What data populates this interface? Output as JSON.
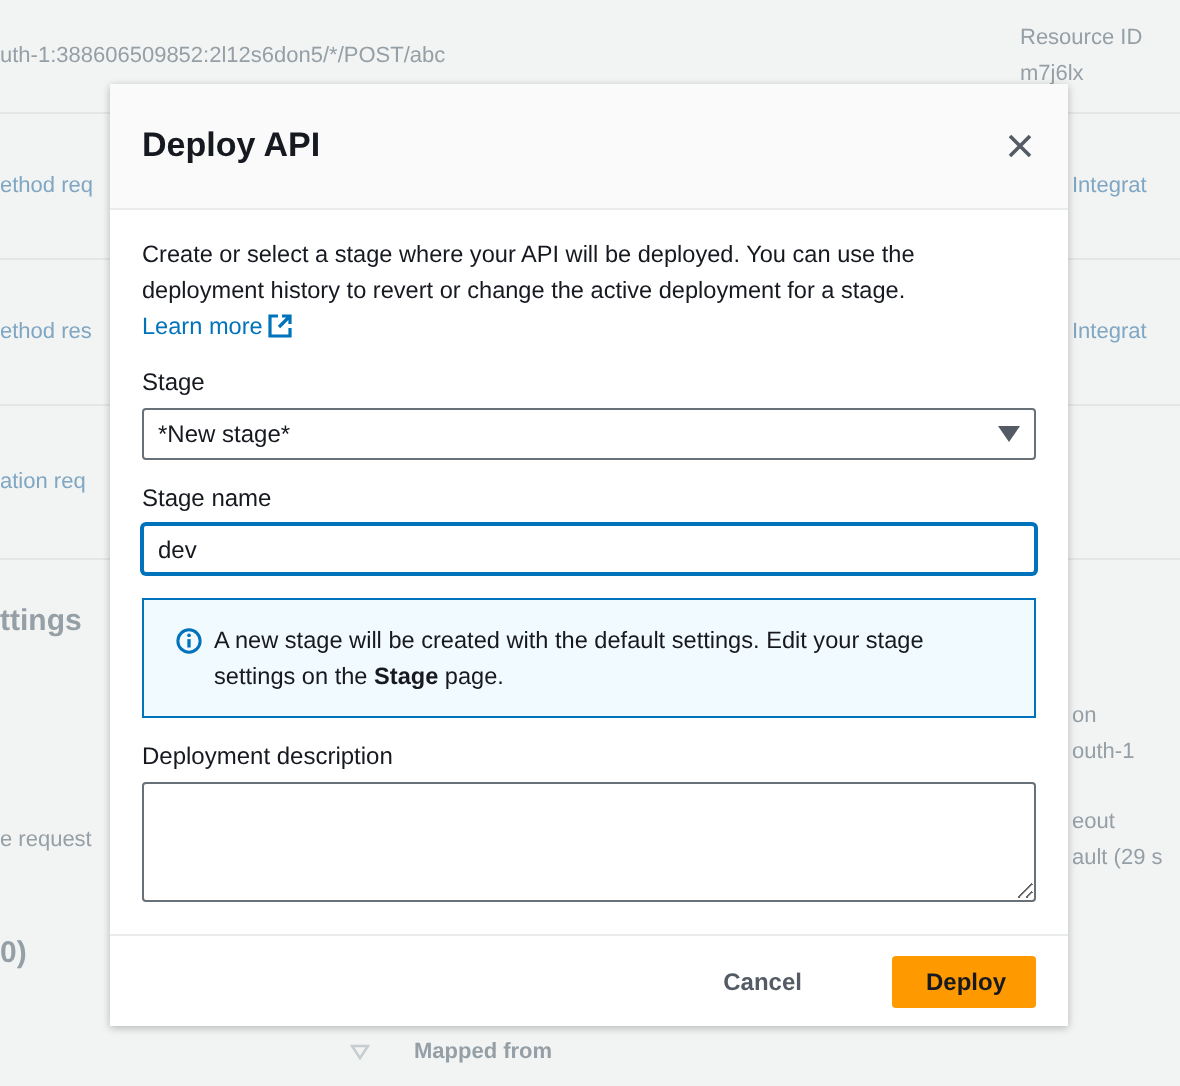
{
  "background": {
    "rows": [
      {
        "left": "uth-1:388606509852:2l12s6don5/*/POST/abc",
        "right": [
          "Resource ID",
          "m7j6lx"
        ]
      },
      {
        "left": "ethod req",
        "right": [
          "Integrat"
        ],
        "kind": "link"
      },
      {
        "left": "ethod res",
        "right": [
          "Integrat"
        ],
        "kind": "link"
      },
      {
        "left": "ation req",
        "kind": "link"
      },
      {
        "left": "ttings",
        "kind": "heading"
      },
      {
        "right": [
          "on",
          "outh-1"
        ]
      },
      {
        "left": "e request",
        "right": [
          "eout",
          "ault (29 s"
        ]
      },
      {
        "left": "0)",
        "kind": "heading"
      }
    ],
    "mapped_from": "Mapped from"
  },
  "dialog": {
    "title": "Deploy API",
    "description": "Create or select a stage where your API will be deployed. You can use the deployment history to revert or change the active deployment for a stage.",
    "learn_more": "Learn more",
    "stage": {
      "label": "Stage",
      "value": "*New stage*"
    },
    "stage_name": {
      "label": "Stage name",
      "value": "dev",
      "focused": true
    },
    "info": "A new stage will be created with the default settings. Edit your stage settings on the **Stage** page.",
    "deployment_description": {
      "label": "Deployment description"
    },
    "buttons": [
      {
        "label": "Cancel",
        "kind": "link"
      },
      {
        "label": "Deploy",
        "kind": "primary"
      }
    ]
  }
}
